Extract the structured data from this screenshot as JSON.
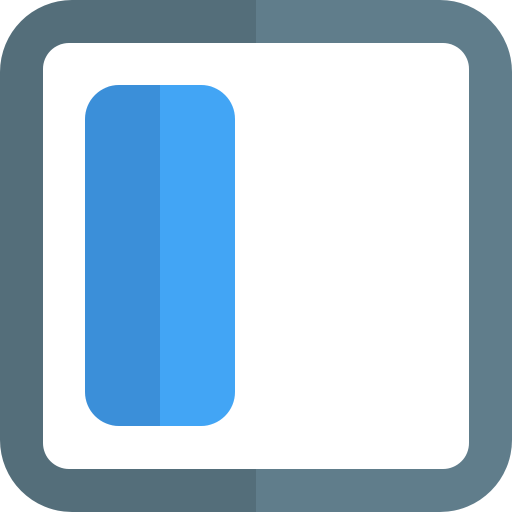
{
  "icon": {
    "name": "left-sidebar-layout-icon",
    "colors": {
      "frame_left": "#546E7A",
      "frame_right": "#607D8B",
      "panel_left": "#3B8FD9",
      "panel_right": "#42A5F5",
      "background": "#FFFFFF"
    }
  }
}
